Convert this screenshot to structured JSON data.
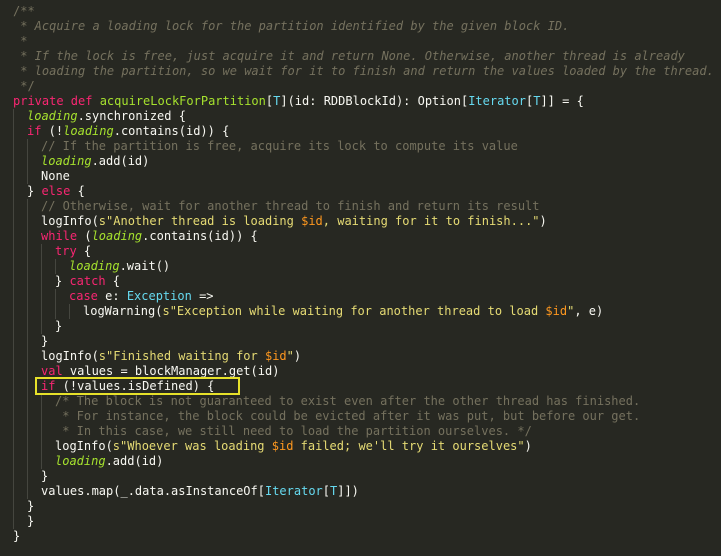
{
  "editor": {
    "theme": "monokai",
    "highlight_color": "#e6e12a",
    "highlighted_line": 25,
    "lines": [
      {
        "indent": 0,
        "tokens": [
          {
            "c": "comment",
            "t": "/**"
          }
        ]
      },
      {
        "indent": 0,
        "tokens": [
          {
            "c": "comment-it",
            "t": " * Acquire a loading lock for the partition identified by the given block ID."
          }
        ]
      },
      {
        "indent": 0,
        "tokens": [
          {
            "c": "comment-it",
            "t": " *"
          }
        ]
      },
      {
        "indent": 0,
        "tokens": [
          {
            "c": "comment-it",
            "t": " * If the lock is free, just acquire it and return None. Otherwise, another thread is already"
          }
        ]
      },
      {
        "indent": 0,
        "tokens": [
          {
            "c": "comment-it",
            "t": " * loading the partition, so we wait for it to finish and return the values loaded by the thread."
          }
        ]
      },
      {
        "indent": 0,
        "tokens": [
          {
            "c": "comment",
            "t": " */"
          }
        ]
      },
      {
        "indent": 0,
        "tokens": [
          {
            "c": "keyword",
            "t": "private def "
          },
          {
            "c": "fn",
            "t": "acquireLockForPartition"
          },
          {
            "c": "plain",
            "t": "["
          },
          {
            "c": "type",
            "t": "T"
          },
          {
            "c": "plain",
            "t": "](id: RDDBlockId): Option["
          },
          {
            "c": "type",
            "t": "Iterator"
          },
          {
            "c": "plain",
            "t": "["
          },
          {
            "c": "type",
            "t": "T"
          },
          {
            "c": "plain",
            "t": "]] = {"
          }
        ]
      },
      {
        "indent": 1,
        "tokens": [
          {
            "c": "var",
            "t": "loading"
          },
          {
            "c": "plain",
            "t": ".synchronized {"
          }
        ]
      },
      {
        "indent": 1,
        "tokens": [
          {
            "c": "keyword",
            "t": "if"
          },
          {
            "c": "plain",
            "t": " (!"
          },
          {
            "c": "var",
            "t": "loading"
          },
          {
            "c": "plain",
            "t": ".contains(id)) {"
          }
        ]
      },
      {
        "indent": 2,
        "tokens": [
          {
            "c": "comment",
            "t": "// If the partition is free, acquire its lock to compute its value"
          }
        ]
      },
      {
        "indent": 2,
        "tokens": [
          {
            "c": "var",
            "t": "loading"
          },
          {
            "c": "plain",
            "t": ".add(id)"
          }
        ]
      },
      {
        "indent": 2,
        "tokens": [
          {
            "c": "plain",
            "t": "None"
          }
        ]
      },
      {
        "indent": 1,
        "tokens": [
          {
            "c": "plain",
            "t": "} "
          },
          {
            "c": "keyword",
            "t": "else"
          },
          {
            "c": "plain",
            "t": " {"
          }
        ]
      },
      {
        "indent": 2,
        "tokens": [
          {
            "c": "comment",
            "t": "// Otherwise, wait for another thread to finish and return its result"
          }
        ]
      },
      {
        "indent": 2,
        "tokens": [
          {
            "c": "plain",
            "t": "logInfo("
          },
          {
            "c": "string",
            "t": "s\"Another thread is loading "
          },
          {
            "c": "interp",
            "t": "$id"
          },
          {
            "c": "string",
            "t": ", waiting for it to finish...\""
          },
          {
            "c": "plain",
            "t": ")"
          }
        ]
      },
      {
        "indent": 2,
        "tokens": [
          {
            "c": "keyword",
            "t": "while"
          },
          {
            "c": "plain",
            "t": " ("
          },
          {
            "c": "var",
            "t": "loading"
          },
          {
            "c": "plain",
            "t": ".contains(id)) {"
          }
        ]
      },
      {
        "indent": 3,
        "tokens": [
          {
            "c": "keyword",
            "t": "try"
          },
          {
            "c": "plain",
            "t": " {"
          }
        ]
      },
      {
        "indent": 4,
        "tokens": [
          {
            "c": "var",
            "t": "loading"
          },
          {
            "c": "plain",
            "t": ".wait()"
          }
        ]
      },
      {
        "indent": 3,
        "tokens": [
          {
            "c": "plain",
            "t": "} "
          },
          {
            "c": "keyword",
            "t": "catch"
          },
          {
            "c": "plain",
            "t": " {"
          }
        ]
      },
      {
        "indent": 4,
        "tokens": [
          {
            "c": "keyword",
            "t": "case"
          },
          {
            "c": "plain",
            "t": " e: "
          },
          {
            "c": "type",
            "t": "Exception"
          },
          {
            "c": "plain",
            "t": " =>"
          }
        ]
      },
      {
        "indent": 5,
        "tokens": [
          {
            "c": "plain",
            "t": "logWarning("
          },
          {
            "c": "string",
            "t": "s\"Exception while waiting for another thread to load "
          },
          {
            "c": "interp",
            "t": "$id"
          },
          {
            "c": "string",
            "t": "\""
          },
          {
            "c": "plain",
            "t": ", e)"
          }
        ]
      },
      {
        "indent": 3,
        "tokens": [
          {
            "c": "plain",
            "t": "}"
          }
        ]
      },
      {
        "indent": 2,
        "tokens": [
          {
            "c": "plain",
            "t": "}"
          }
        ]
      },
      {
        "indent": 2,
        "tokens": [
          {
            "c": "plain",
            "t": "logInfo("
          },
          {
            "c": "string",
            "t": "s\"Finished waiting for "
          },
          {
            "c": "interp",
            "t": "$id"
          },
          {
            "c": "string",
            "t": "\""
          },
          {
            "c": "plain",
            "t": ")"
          }
        ]
      },
      {
        "indent": 2,
        "tokens": [
          {
            "c": "keyword",
            "t": "val"
          },
          {
            "c": "plain",
            "t": " values = blockManager.get(id)"
          }
        ]
      },
      {
        "indent": 2,
        "tokens": [
          {
            "c": "keyword",
            "t": "if"
          },
          {
            "c": "plain",
            "t": " (!values.isDefined) {"
          }
        ]
      },
      {
        "indent": 3,
        "tokens": [
          {
            "c": "comment",
            "t": "/* The block is not guaranteed to exist even after the other thread has finished."
          }
        ]
      },
      {
        "indent": 3,
        "tokens": [
          {
            "c": "comment",
            "t": " * For instance, the block could be evicted after it was put, but before our get."
          }
        ]
      },
      {
        "indent": 3,
        "tokens": [
          {
            "c": "comment",
            "t": " * In this case, we still need to load the partition ourselves. */"
          }
        ]
      },
      {
        "indent": 3,
        "tokens": [
          {
            "c": "plain",
            "t": "logInfo("
          },
          {
            "c": "string",
            "t": "s\"Whoever was loading "
          },
          {
            "c": "interp",
            "t": "$id"
          },
          {
            "c": "string",
            "t": " failed; we'll try it ourselves\""
          },
          {
            "c": "plain",
            "t": ")"
          }
        ]
      },
      {
        "indent": 3,
        "tokens": [
          {
            "c": "var",
            "t": "loading"
          },
          {
            "c": "plain",
            "t": ".add(id)"
          }
        ]
      },
      {
        "indent": 2,
        "tokens": [
          {
            "c": "plain",
            "t": "}"
          }
        ]
      },
      {
        "indent": 2,
        "tokens": [
          {
            "c": "plain",
            "t": "values.map(_.data.asInstanceOf["
          },
          {
            "c": "type",
            "t": "Iterator"
          },
          {
            "c": "plain",
            "t": "["
          },
          {
            "c": "type",
            "t": "T"
          },
          {
            "c": "plain",
            "t": "]])"
          }
        ]
      },
      {
        "indent": 1,
        "tokens": [
          {
            "c": "plain",
            "t": "}"
          }
        ]
      },
      {
        "indent": 1,
        "tokens": [
          {
            "c": "plain",
            "t": "}"
          }
        ]
      },
      {
        "indent": 0,
        "tokens": [
          {
            "c": "plain",
            "t": "}"
          }
        ]
      }
    ]
  }
}
